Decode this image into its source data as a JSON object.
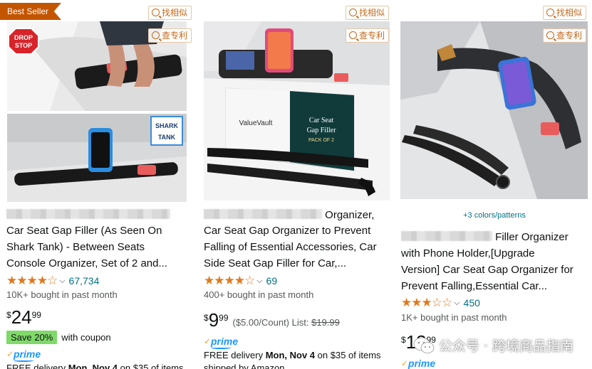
{
  "cards": [
    {
      "badge": "Best Seller",
      "find_similar": "找相似",
      "check_patent": "查专利",
      "title_suffix": "",
      "title_lines": [
        "Car Seat Gap Filler (As Seen On",
        "Shark Tank) - Between Seats",
        "Console Organizer, Set of 2 and..."
      ],
      "rating_count": "67,734",
      "rating_value": 4.5,
      "bought": "10K+ bought in past month",
      "price_symbol": "$",
      "price_whole": "24",
      "price_fraction": "99",
      "coupon_save": "Save 20%",
      "coupon_text": "with coupon",
      "prime_label": "prime",
      "delivery_prefix": "FREE delivery",
      "delivery_date": "Mon, Nov 4",
      "delivery_suffix": "on $35 of items",
      "image_labels": {
        "drop_stop_1": "DROP",
        "drop_stop_2": "STOP",
        "shark_1": "SHARK",
        "shark_2": "TANK"
      }
    },
    {
      "find_similar": "找相似",
      "check_patent": "查专利",
      "title_suffix": "Organizer,",
      "title_lines": [
        "Car Seat Gap Organizer to Prevent",
        "Falling of Essential Accessories, Car",
        "Side Seat Gap Filler for Car,..."
      ],
      "rating_count": "69",
      "rating_value": 4.5,
      "bought": "400+ bought in past month",
      "price_symbol": "$",
      "price_whole": "9",
      "price_fraction": "99",
      "unit_price": "($5.00/Count)",
      "list_label": "List:",
      "list_price": "$19.99",
      "prime_label": "prime",
      "delivery_prefix": "FREE delivery",
      "delivery_date": "Mon, Nov 4",
      "delivery_suffix": "on $35 of items",
      "shipped": "shipped by Amazon",
      "image_labels": {
        "brand": "ValueVault",
        "box_1": "Car Seat",
        "box_2": "Gap Filler",
        "box_3": "PACK OF 2"
      }
    },
    {
      "find_similar": "找相似",
      "check_patent": "查专利",
      "colors_link": "+3 colors/patterns",
      "title_suffix": "Filler Organizer",
      "title_lines": [
        "with Phone Holder,[Upgrade",
        "Version] Car Seat Gap Organizer for",
        "Prevent Falling,Essential Car..."
      ],
      "rating_count": "450",
      "rating_value": 3.5,
      "bought": "1K+ bought in past month",
      "price_symbol": "$",
      "price_whole": "13",
      "price_fraction": "99",
      "prime_label": "prime"
    }
  ],
  "stars": {
    "c1": "★★★★☆",
    "c2": "★★★★☆",
    "c3": "★★★☆☆"
  },
  "watermark": {
    "text": "公众号 · 跨境商品指南"
  },
  "colors": {
    "badge": "#c45500",
    "link": "#007185",
    "star": "#de7921",
    "prime": "#1a98ff",
    "coupon": "#7fda69"
  }
}
